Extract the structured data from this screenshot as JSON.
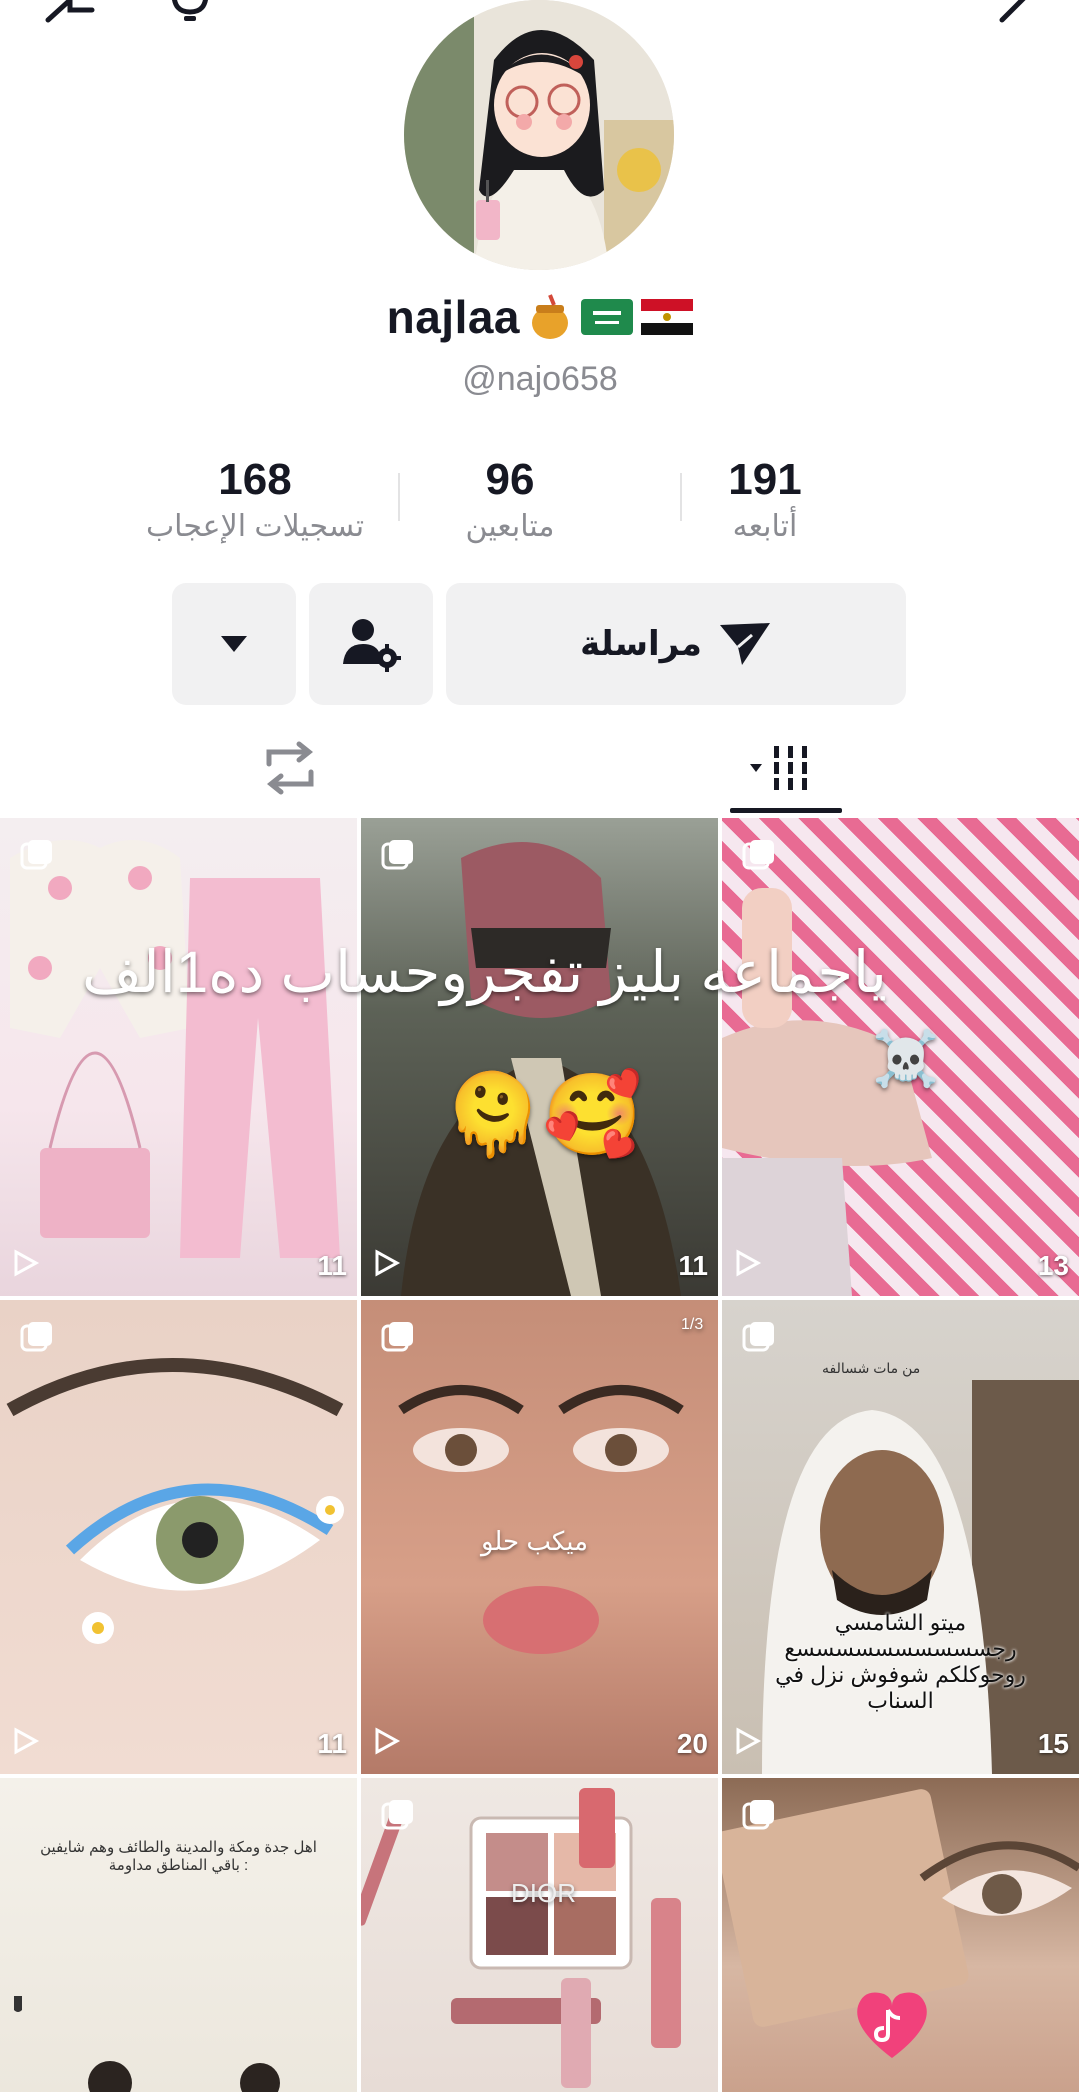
{
  "profile": {
    "display_name": "najlaa",
    "name_badges": [
      "honey-pot-emoji",
      "saudi-flag",
      "egypt-flag"
    ],
    "username": "@najo658"
  },
  "stats": {
    "likes": {
      "value": "168",
      "label": "تسجيلات الإعجاب"
    },
    "followers": {
      "value": "96",
      "label": "متابعين"
    },
    "following": {
      "value": "191",
      "label": "أتابعه"
    }
  },
  "actions": {
    "message_label": "مراسلة"
  },
  "tabs": [
    {
      "name": "videos",
      "icon": "grid-icon",
      "active": true
    },
    {
      "name": "reposts",
      "icon": "repost-icon",
      "active": false
    }
  ],
  "overlay_caption": "ياجماعه بليز تفجروحساب ده1الف",
  "videos": [
    {
      "count": "11",
      "theme": "pink-outfit"
    },
    {
      "count": "11",
      "theme": "man-shemagh",
      "emojis": "🫠🥰"
    },
    {
      "count": "13",
      "theme": "red-shemagh",
      "emojis": "☠️"
    },
    {
      "count": "11",
      "theme": "blue-eye-makeup"
    },
    {
      "count": "20",
      "theme": "face-makeup",
      "caption": "ميكب حلو",
      "page": "1/3"
    },
    {
      "count": "15",
      "theme": "man-selfie",
      "top_caption": "من مات شسالفه",
      "caption_lines": [
        "ميتو الشامسي",
        "رجسسسسسسسسسسع",
        "روحوكلكم شوفوش نزل في",
        "السناب"
      ]
    },
    {
      "count": "",
      "theme": "two-people",
      "caption_lines": [
        "اهل جدة ومكة والمدينة والطائف وهم شايفين",
        "باقي المناطق مداومة :"
      ]
    },
    {
      "count": "",
      "theme": "dior-makeup",
      "product_text": "DIOR"
    },
    {
      "count": "",
      "theme": "palette-eye"
    }
  ],
  "colors": {
    "text_primary": "#161823",
    "text_secondary": "#8a8b91",
    "button_bg": "#f1f1f2",
    "divider": "#e3e3e4"
  }
}
